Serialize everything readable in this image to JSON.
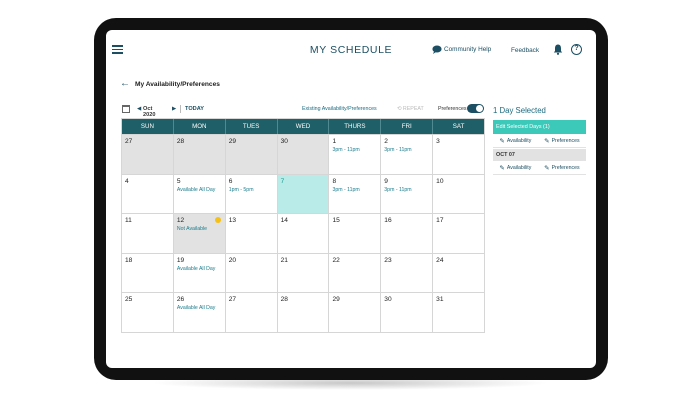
{
  "header": {
    "title": "MY SCHEDULE",
    "community_help": "Community Help",
    "feedback": "Feedback",
    "help_glyph": "?",
    "icons": [
      "hamburger-icon",
      "chat-bubble-icon",
      "bell-icon",
      "help-circle-icon"
    ]
  },
  "breadcrumb": {
    "back_arrow": "←",
    "label": "My Availability/Preferences"
  },
  "toolbar": {
    "prev": "◀",
    "month": "Oct 2020",
    "next": "▶",
    "today": "TODAY",
    "existing": "Existing Availability/Preferences",
    "repeat": "REPEAT",
    "preferences": "Preferences",
    "preferences_on": true
  },
  "calendar": {
    "weekdays": [
      "SUN",
      "MON",
      "TUES",
      "WED",
      "THURS",
      "FRI",
      "SAT"
    ],
    "weeks": [
      [
        {
          "day": "27",
          "note": "",
          "state": "grey"
        },
        {
          "day": "28",
          "note": "",
          "state": "grey"
        },
        {
          "day": "29",
          "note": "",
          "state": "grey"
        },
        {
          "day": "30",
          "note": "",
          "state": "grey"
        },
        {
          "day": "1",
          "note": "3pm - 11pm",
          "state": ""
        },
        {
          "day": "2",
          "note": "3pm - 11pm",
          "state": ""
        },
        {
          "day": "3",
          "note": "",
          "state": ""
        }
      ],
      [
        {
          "day": "4",
          "note": "",
          "state": ""
        },
        {
          "day": "5",
          "note": "Available All Day",
          "state": ""
        },
        {
          "day": "6",
          "note": "1pm - 5pm",
          "state": ""
        },
        {
          "day": "7",
          "note": "",
          "state": "selected"
        },
        {
          "day": "8",
          "note": "3pm - 11pm",
          "state": ""
        },
        {
          "day": "9",
          "note": "3pm - 11pm",
          "state": ""
        },
        {
          "day": "10",
          "note": "",
          "state": ""
        }
      ],
      [
        {
          "day": "11",
          "note": "",
          "state": ""
        },
        {
          "day": "12",
          "note": "Not Available",
          "state": "grey",
          "dot": true
        },
        {
          "day": "13",
          "note": "",
          "state": ""
        },
        {
          "day": "14",
          "note": "",
          "state": ""
        },
        {
          "day": "15",
          "note": "",
          "state": ""
        },
        {
          "day": "16",
          "note": "",
          "state": ""
        },
        {
          "day": "17",
          "note": "",
          "state": ""
        }
      ],
      [
        {
          "day": "18",
          "note": "",
          "state": ""
        },
        {
          "day": "19",
          "note": "Available All Day",
          "state": ""
        },
        {
          "day": "20",
          "note": "",
          "state": ""
        },
        {
          "day": "21",
          "note": "",
          "state": ""
        },
        {
          "day": "22",
          "note": "",
          "state": ""
        },
        {
          "day": "23",
          "note": "",
          "state": ""
        },
        {
          "day": "24",
          "note": "",
          "state": ""
        }
      ],
      [
        {
          "day": "25",
          "note": "",
          "state": ""
        },
        {
          "day": "26",
          "note": "Available All Day",
          "state": ""
        },
        {
          "day": "27",
          "note": "",
          "state": ""
        },
        {
          "day": "28",
          "note": "",
          "state": ""
        },
        {
          "day": "29",
          "note": "",
          "state": ""
        },
        {
          "day": "30",
          "note": "",
          "state": ""
        },
        {
          "day": "31",
          "note": "",
          "state": ""
        }
      ]
    ]
  },
  "panel": {
    "title": "1 Day Selected",
    "edit_button": "Edit Selected Days (1)",
    "availability": "Availability",
    "preferences": "Preferences",
    "date_header": "OCT 07"
  },
  "colors": {
    "brand": "#1c4f63",
    "header_bg": "#1f5f67",
    "accent": "#3cc9b9",
    "selected": "#b9ece8",
    "unavailable_dot": "#f5c116"
  }
}
